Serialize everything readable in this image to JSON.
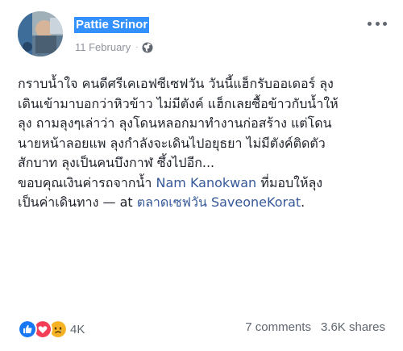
{
  "author": {
    "name": "Pattie Srinor"
  },
  "meta": {
    "date": "11 February",
    "separator": "·",
    "privacy_icon": "globe-icon"
  },
  "post": {
    "lines": [
      "กราบน้ำใจ คนดีศรีเคเอฟซีเซฟวัน วันนี้แฮ็กรับออเดอร์ ลุง",
      "เดินเข้ามาบอกว่าหิวข้าว ไม่มีตังค์ แฮ็กเลยซื้อข้าวกับน้ำให้",
      "ลุง ถามลุงๆเล่าว่า ลุงโดนหลอกมาทำงานก่อสร้าง แต่โดน",
      "นายหน้าลอยแพ ลุงกำลังจะเดินไปอยุธยา ไม่มีตังค์ติดตัว",
      "สักบาท ลุงเป็นคนบึงกาฬ ซึ้งไปอีก..."
    ],
    "thanks_prefix": "ขอบคุณเงินค่ารถจากน้ำ ",
    "tagged_person": "Nam Kanokwan",
    "thanks_suffix": " ที่มอบให้ลุง",
    "last_line_prefix": "เป็นค่าเดินทาง — at ",
    "location": "ตลาดเซฟวัน SaveoneKorat",
    "location_tail": "."
  },
  "reactions": {
    "icons": [
      "like-icon",
      "love-icon",
      "sad-icon"
    ],
    "count": "4K"
  },
  "stats": {
    "comments": "7 comments",
    "shares": "3.6K shares"
  },
  "colors": {
    "link": "#365899",
    "highlight": "#3390ff",
    "like": "#1877f2",
    "love": "#f33e58",
    "sad": "#f7b125"
  }
}
